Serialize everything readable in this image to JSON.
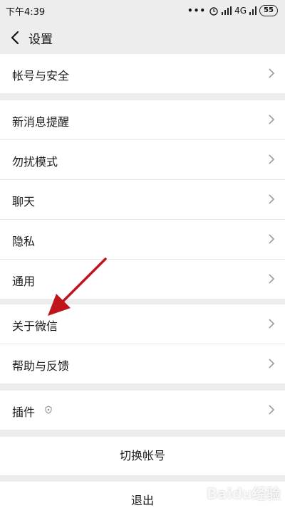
{
  "status_bar": {
    "time": "下午4:39",
    "dots": "•••",
    "network": "4G",
    "battery": "55"
  },
  "nav": {
    "title": "设置"
  },
  "groups": [
    {
      "items": [
        {
          "label": "帐号与安全"
        }
      ]
    },
    {
      "items": [
        {
          "label": "新消息提醒"
        },
        {
          "label": "勿扰模式"
        },
        {
          "label": "聊天"
        },
        {
          "label": "隐私"
        },
        {
          "label": "通用"
        }
      ]
    },
    {
      "items": [
        {
          "label": "关于微信"
        },
        {
          "label": "帮助与反馈"
        }
      ]
    },
    {
      "items": [
        {
          "label": "插件"
        }
      ]
    }
  ],
  "actions": {
    "switch_account": "切换帐号",
    "logout": "退出"
  },
  "colors": {
    "arrow": "#c0141c",
    "background": "#ededed"
  },
  "watermark": "Baidu经验"
}
